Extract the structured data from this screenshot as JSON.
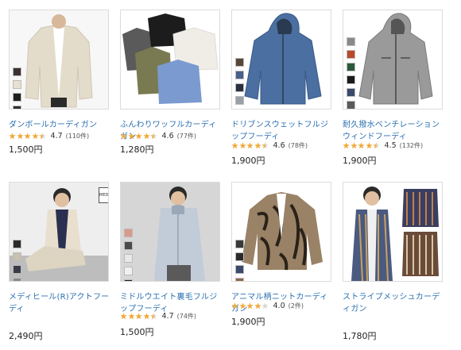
{
  "products": [
    {
      "name": "ダンボールカーディガン",
      "rating": "4.7",
      "reviews": "(110件)",
      "stars": 4.5,
      "price": "1,500円",
      "swatches": [
        "#3b3230",
        "#e8e0d0",
        "#1f1f1f",
        "#2d2d2d"
      ]
    },
    {
      "name": "ふんわりワッフルカーディガン",
      "rating": "4.6",
      "reviews": "(77件)",
      "stars": 4.5,
      "price": "1,280円",
      "swatches": []
    },
    {
      "name": "ドリブンスウェットフルジップフーディ",
      "rating": "4.6",
      "reviews": "(78件)",
      "stars": 4.5,
      "price": "1,900円",
      "swatches": [
        "#5a4638",
        "#4a5f8a",
        "#2a3040",
        "#9aa0a8",
        "#c8c2b8",
        "#111111"
      ]
    },
    {
      "name": "耐久撥水ベンチレーションウィンドフーディ",
      "rating": "4.5",
      "reviews": "(132件)",
      "stars": 4.5,
      "price": "1,900円",
      "swatches": [
        "#8a8a8a",
        "#b84a2a",
        "#2a5a3a",
        "#1a1a1a",
        "#3a4a6a",
        "#5a5a5a",
        "#c8902a"
      ]
    },
    {
      "name": "メディヒール(R)アクトフーディ",
      "rating": "",
      "reviews": "",
      "stars": 0,
      "price": "2,490円",
      "badge": "MEDIHEAL",
      "swatches": [
        "#2a2a2a",
        "#c8c0b0",
        "#3a3a4a",
        "#888888"
      ]
    },
    {
      "name": "ミドルウエイト裏毛フルジップフーディ",
      "rating": "4.7",
      "reviews": "(74件)",
      "stars": 4.5,
      "price": "1,500円",
      "swatches": [
        "#d89a8a",
        "#4a4a4a",
        "#e8e8e8",
        "#f0f0f0",
        "#1a1a1a"
      ]
    },
    {
      "name": "アニマル柄ニットカーディガン",
      "rating": "4.0",
      "reviews": "(2件)",
      "stars": 4,
      "price": "1,900円",
      "swatches": [
        "#3a3a3a",
        "#2a2a2a",
        "#3a4a6a",
        "#8a6a4a"
      ]
    },
    {
      "name": "ストライプメッシュカーディガン",
      "rating": "",
      "reviews": "",
      "stars": 0,
      "price": "1,780円",
      "swatches": []
    }
  ],
  "colors": {
    "link": "#2a6fb0",
    "star": "#f0a93a",
    "star_empty": "#d8d8d8"
  }
}
